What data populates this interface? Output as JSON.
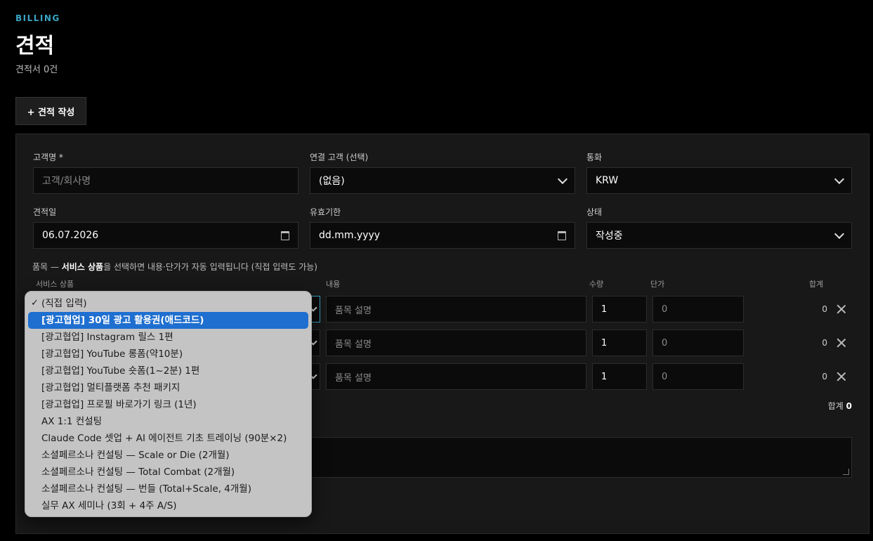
{
  "header": {
    "eyebrow": "BILLING",
    "title": "견적",
    "subtitle": "견적서 0건",
    "new_button": "+ 견적 작성"
  },
  "form": {
    "customer_label": "고객명 *",
    "customer_placeholder": "고객/회사명",
    "linked_label": "연결 고객 (선택)",
    "linked_value": "(없음)",
    "currency_label": "통화",
    "currency_value": "KRW",
    "date_label": "견적일",
    "date_value": "06.07.2026",
    "valid_label": "유효기한",
    "valid_value": "dd.mm.yyyy",
    "status_label": "상태",
    "status_value": "작성중"
  },
  "items": {
    "hint_prefix": "품목 — ",
    "hint_bold": "서비스 상품",
    "hint_suffix": "을 선택하면 내용·단가가 자동 입력됩니다 (직접 입력도 가능)",
    "columns": {
      "product": "서비스 상품",
      "content": "내용",
      "qty": "수량",
      "price": "단가",
      "sum": "합계"
    },
    "rows": [
      {
        "content_placeholder": "품목 설명",
        "qty": "1",
        "price_placeholder": "0",
        "amount": "0"
      },
      {
        "content_placeholder": "품목 설명",
        "qty": "1",
        "price_placeholder": "0",
        "amount": "0"
      },
      {
        "content_placeholder": "품목 설명",
        "qty": "1",
        "price_placeholder": "0",
        "amount": "0"
      }
    ],
    "total_label": "합계",
    "total_value": "0"
  },
  "dropdown": {
    "selected_index": 1,
    "options": [
      "(직접 입력)",
      "[광고협업] 30일 광고 활용권(애드코드)",
      "[광고협업] Instagram 릴스 1편",
      "[광고협업] YouTube 롱폼(약10분)",
      "[광고협업] YouTube 숏폼(1~2분) 1편",
      "[광고협업] 멀티플랫폼 추천 패키지",
      "[광고협업] 프로필 바로가기 링크 (1년)",
      "AX 1:1 컨설팅",
      "Claude Code 셋업 + AI 에이전트 기초 트레이닝 (90분×2)",
      "소셜페르소나 컨설팅 — Scale or Die (2개월)",
      "소셜페르소나 컨설팅 — Total Combat (2개월)",
      "소셜페르소나 컨설팅 — 번들 (Total+Scale, 4개월)",
      "실무 AX 세미나 (3회 + 4주 A/S)"
    ],
    "check_glyph": "✓"
  }
}
